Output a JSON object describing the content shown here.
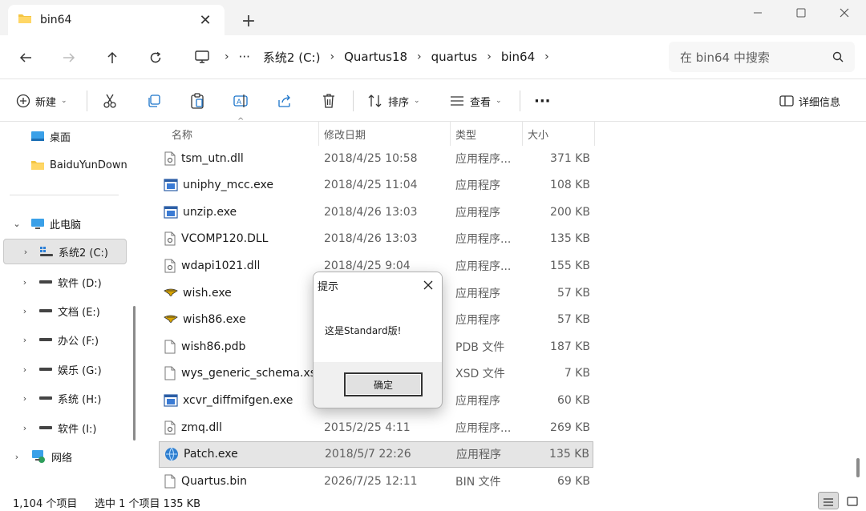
{
  "tab": {
    "title": "bin64"
  },
  "breadcrumb": [
    "系统2 (C:)",
    "Quartus18",
    "quartus",
    "bin64"
  ],
  "breadcrumb_more": "···",
  "search": {
    "placeholder": "在 bin64 中搜索"
  },
  "toolbar": {
    "new_label": "新建",
    "sort_label": "排序",
    "view_label": "查看",
    "details_label": "详细信息"
  },
  "sidebar": {
    "pinned": [
      {
        "label": "桌面"
      },
      {
        "label": "BaiduYunDownload"
      }
    ],
    "this_pc": "此电脑",
    "drives": [
      {
        "label": "系统2 (C:)"
      },
      {
        "label": "软件 (D:)"
      },
      {
        "label": "文档 (E:)"
      },
      {
        "label": "办公 (F:)"
      },
      {
        "label": "娱乐 (G:)"
      },
      {
        "label": "系统 (H:)"
      },
      {
        "label": "软件 (I:)"
      }
    ],
    "network": "网络"
  },
  "columns": {
    "name": "名称",
    "date": "修改日期",
    "type": "类型",
    "size": "大小"
  },
  "files": [
    {
      "name": "tsm_utn.dll",
      "date": "2018/4/25 10:58",
      "type": "应用程序...",
      "size": "371 KB",
      "icon": "dll"
    },
    {
      "name": "uniphy_mcc.exe",
      "date": "2018/4/25 11:04",
      "type": "应用程序",
      "size": "108 KB",
      "icon": "exe"
    },
    {
      "name": "unzip.exe",
      "date": "2018/4/26 13:03",
      "type": "应用程序",
      "size": "200 KB",
      "icon": "exe"
    },
    {
      "name": "VCOMP120.DLL",
      "date": "2018/4/26 13:03",
      "type": "应用程序...",
      "size": "135 KB",
      "icon": "dll"
    },
    {
      "name": "wdapi1021.dll",
      "date": "2018/4/25 9:04",
      "type": "应用程序...",
      "size": "155 KB",
      "icon": "dll"
    },
    {
      "name": "wish.exe",
      "date": "",
      "type": "应用程序",
      "size": "57 KB",
      "icon": "feather"
    },
    {
      "name": "wish86.exe",
      "date": "",
      "type": "应用程序",
      "size": "57 KB",
      "icon": "feather"
    },
    {
      "name": "wish86.pdb",
      "date": "",
      "type": "PDB 文件",
      "size": "187 KB",
      "icon": "doc"
    },
    {
      "name": "wys_generic_schema.xsd",
      "date": "",
      "type": "XSD 文件",
      "size": "7 KB",
      "icon": "doc"
    },
    {
      "name": "xcvr_diffmifgen.exe",
      "date": "",
      "type": "应用程序",
      "size": "60 KB",
      "icon": "exe"
    },
    {
      "name": "zmq.dll",
      "date": "2015/2/25 4:11",
      "type": "应用程序...",
      "size": "269 KB",
      "icon": "dll"
    },
    {
      "name": "Patch.exe",
      "date": "2018/5/7 22:26",
      "type": "应用程序",
      "size": "135 KB",
      "icon": "globe",
      "selected": true
    },
    {
      "name": "Quartus.bin",
      "date": "2026/7/25 12:11",
      "type": "BIN 文件",
      "size": "69 KB",
      "icon": "doc"
    }
  ],
  "status": {
    "count": "1,104 个项目",
    "selection": "选中 1 个项目 135 KB"
  },
  "dialog": {
    "title": "提示",
    "message": "这是Standard版!",
    "ok_label": "确定"
  },
  "colors": {
    "accent": "#0067c0",
    "selection": "#e5e5e5",
    "folder": "#f4c542"
  }
}
